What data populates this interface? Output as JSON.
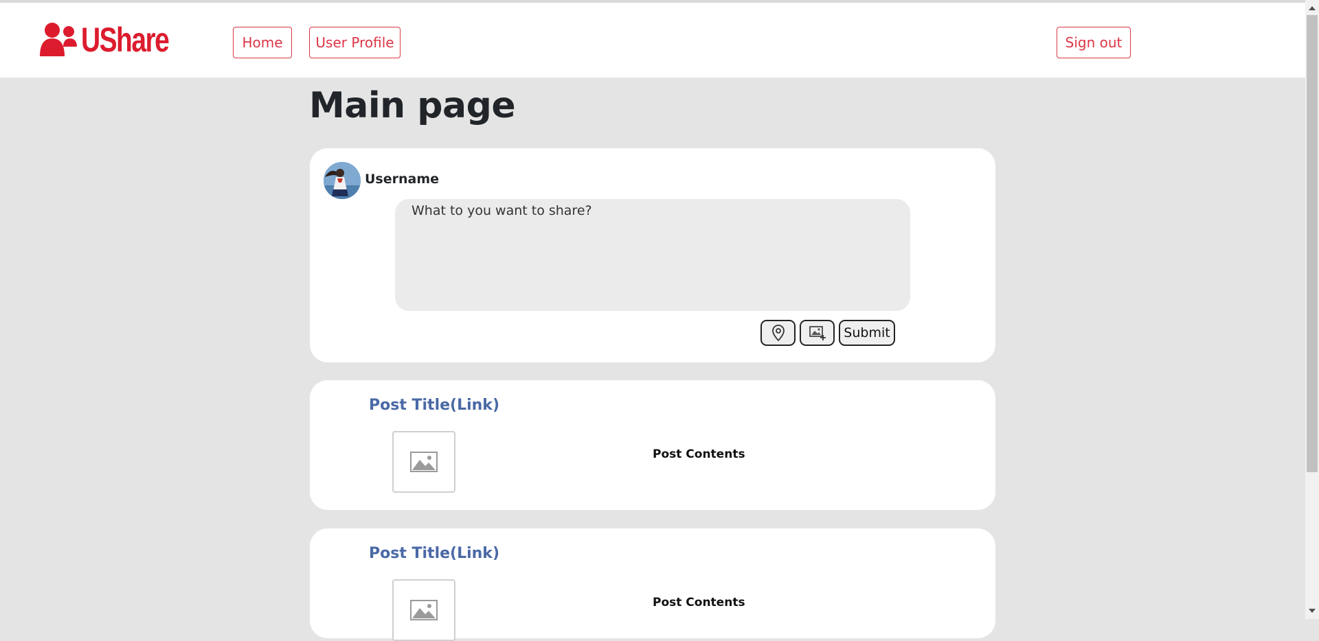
{
  "app": {
    "brand": "UShare",
    "brand_color": "#dc1c2e"
  },
  "nav": {
    "home_label": "Home",
    "profile_label": "User Profile",
    "signout_label": "Sign out",
    "accent": "#dc3545"
  },
  "page": {
    "title": "Main page"
  },
  "composer": {
    "username": "Username",
    "placeholder": "What to you want to share?",
    "location_icon": "map-pin-icon",
    "image_icon": "add-image-icon",
    "submit_label": "Submit"
  },
  "posts": [
    {
      "title": "Post Title(Link)",
      "contents": "Post Contents",
      "thumb_icon": "image-placeholder-icon"
    },
    {
      "title": "Post Title(Link)",
      "contents": "Post Contents",
      "thumb_icon": "image-placeholder-icon"
    }
  ],
  "colors": {
    "link": "#4a69a5",
    "background": "#e4e4e4",
    "card": "#ffffff"
  }
}
